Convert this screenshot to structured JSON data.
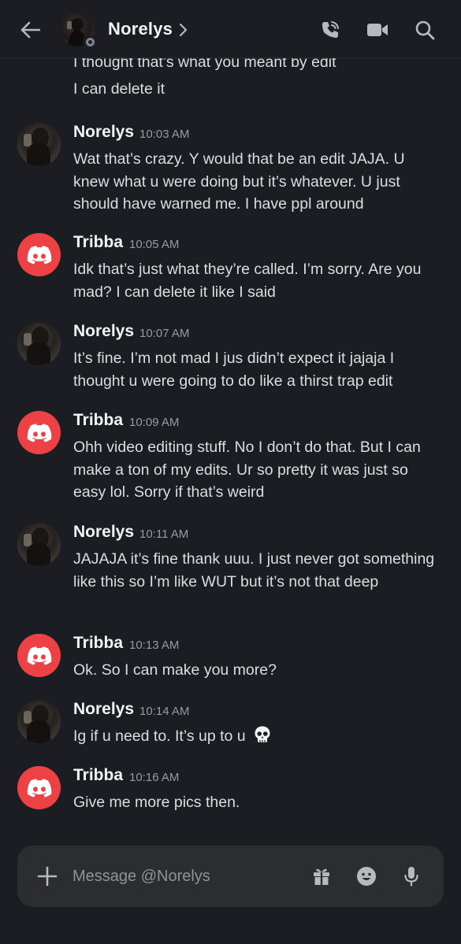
{
  "header": {
    "contact_name": "Norelys",
    "icons": [
      "back-arrow-icon",
      "phone-call-icon",
      "video-camera-icon",
      "search-icon",
      "chevron-right-icon"
    ],
    "status": "offline"
  },
  "continuation_lines": [
    "I thought that’s what you meant by edit",
    "I can delete it"
  ],
  "messages": [
    {
      "author": "Norelys",
      "time": "10:03 AM",
      "avatar": "photo",
      "text": "Wat that’s crazy. Y would that be an edit JAJA. U knew what u were doing but it’s whatever. U just should have warned me. I have ppl around"
    },
    {
      "author": "Tribba",
      "time": "10:05 AM",
      "avatar": "discord-logo",
      "text": "Idk that’s just what they’re called. I’m sorry. Are you mad? I can delete it like I said"
    },
    {
      "author": "Norelys",
      "time": "10:07 AM",
      "avatar": "photo",
      "text": "It’s fine. I’m not mad I jus didn’t expect it jajaja I thought u were going to do like a thirst trap edit"
    },
    {
      "author": "Tribba",
      "time": "10:09 AM",
      "avatar": "discord-logo",
      "text": "Ohh video editing stuff. No I don’t do that. But I can make a ton of my edits. Ur so pretty it was just so easy lol. Sorry if that’s weird"
    },
    {
      "author": "Norelys",
      "time": "10:11 AM",
      "avatar": "photo",
      "text": "JAJAJA it’s fine thank uuu. I just never got something like this so I’m like WUT but it’s not that deep"
    },
    {
      "author": "Tribba",
      "time": "10:13 AM",
      "avatar": "discord-logo",
      "text": "Ok. So I can make you more?"
    },
    {
      "author": "Norelys",
      "time": "10:14 AM",
      "avatar": "photo",
      "text": "Ig if u need to. It’s up to u",
      "emoji": "skull-emoji"
    },
    {
      "author": "Tribba",
      "time": "10:16 AM",
      "avatar": "discord-logo",
      "text": "Give me more pics then."
    }
  ],
  "composer": {
    "placeholder": "Message @Norelys",
    "value": "",
    "icons": [
      "plus-icon",
      "gift-icon",
      "emoji-icon",
      "microphone-icon"
    ]
  },
  "colors": {
    "background": "#1c1d22",
    "composer_bg": "#2b2d31",
    "discord_red": "#ed4245",
    "text": "#dbdee1",
    "timestamp": "#949ba4"
  }
}
